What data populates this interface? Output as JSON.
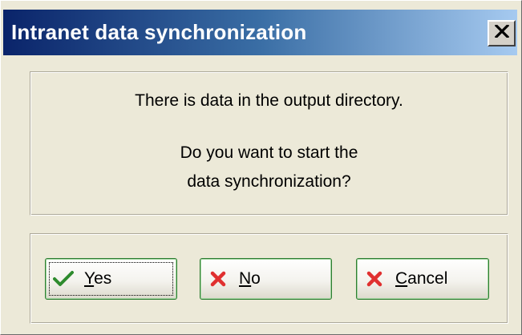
{
  "window": {
    "title": "Intranet data synchronization",
    "close_icon": "close-x-icon"
  },
  "message": {
    "line1": "There is data in the output directory.",
    "line2": "Do you want to start the",
    "line3": "data synchronization?"
  },
  "buttons": {
    "yes": {
      "accel": "Y",
      "rest": "es",
      "icon": "check-icon",
      "icon_color": "#2e8b2e"
    },
    "no": {
      "accel": "N",
      "rest": "o",
      "icon": "red-x-icon",
      "icon_color": "#e03030"
    },
    "cancel": {
      "accel": "C",
      "rest": "ancel",
      "icon": "red-x-icon",
      "icon_color": "#e03030"
    }
  },
  "colors": {
    "titlebar_start": "#0a246a",
    "titlebar_end": "#a6caf0",
    "dialog_bg": "#ece9d8",
    "button_border": "#2e7d32"
  }
}
